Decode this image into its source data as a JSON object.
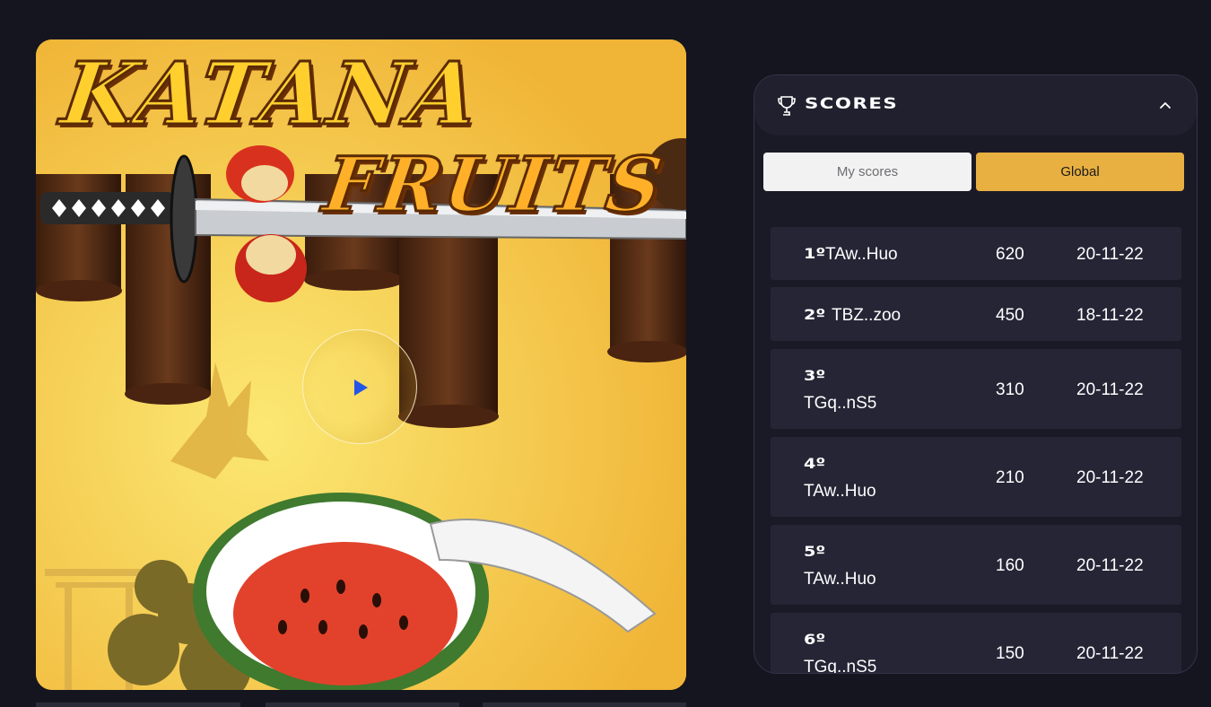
{
  "game": {
    "title_line1": "KATANA",
    "title_line2": "FRUITS",
    "play_icon": "play-icon",
    "colors": {
      "background": "#f3c84a",
      "title_fill": "#ffcf2e",
      "play_triangle": "#2456e6"
    }
  },
  "scores": {
    "title": "SCORES",
    "header_icon": "trophy-icon",
    "collapse_icon": "chevron-up-icon",
    "tabs": [
      {
        "label": "My scores",
        "active": false
      },
      {
        "label": "Global",
        "active": true
      }
    ],
    "colors": {
      "active_tab": "#e8b041",
      "inactive_tab": "#f2f2f2",
      "row": "#252536"
    },
    "rows": [
      {
        "rank": "1º",
        "player": "TAw..Huo",
        "points": "620",
        "date": "20-11-22"
      },
      {
        "rank": "2º",
        "player": "TBZ..zoo",
        "points": "450",
        "date": "18-11-22"
      },
      {
        "rank": "3º",
        "player": "TGq..nS5",
        "points": "310",
        "date": "20-11-22"
      },
      {
        "rank": "4º",
        "player": "TAw..Huo",
        "points": "210",
        "date": "20-11-22"
      },
      {
        "rank": "5º",
        "player": "TAw..Huo",
        "points": "160",
        "date": "20-11-22"
      },
      {
        "rank": "6º",
        "player": "TGq..nS5",
        "points": "150",
        "date": "20-11-22"
      }
    ]
  }
}
